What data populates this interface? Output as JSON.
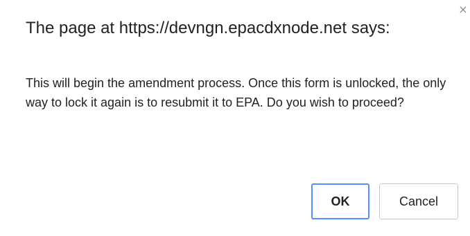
{
  "dialog": {
    "title": "The page at https://devngn.epacdxnode.net says:",
    "close_glyph": "×",
    "message": "This will begin the amendment process. Once this form is unlocked, the only way to lock it again is to resubmit it to EPA. Do you wish to proceed?",
    "ok_label": "OK",
    "cancel_label": "Cancel",
    "focus_color": "#4d90fe"
  }
}
